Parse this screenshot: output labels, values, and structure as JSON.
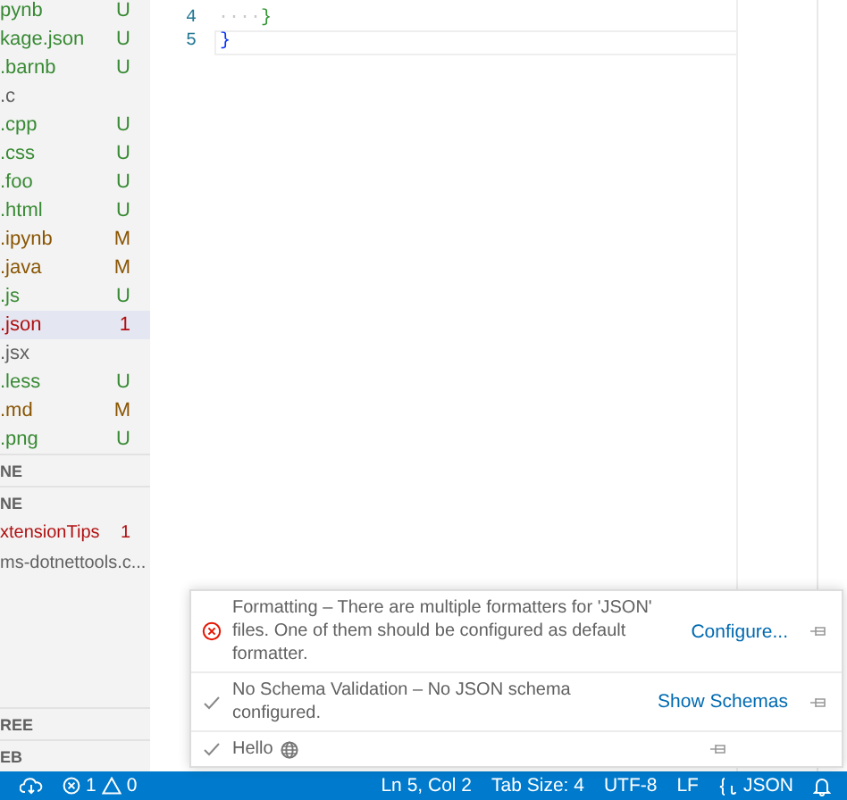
{
  "sidebar": {
    "files": [
      {
        "name": "pynb",
        "status": "U",
        "kind": "untracked",
        "selected": false
      },
      {
        "name": "kage.json",
        "status": "U",
        "kind": "untracked",
        "selected": false
      },
      {
        "name": ".barnb",
        "status": "U",
        "kind": "untracked",
        "selected": false
      },
      {
        "name": ".c",
        "kind": "plain",
        "selected": false
      },
      {
        "name": ".cpp",
        "status": "U",
        "kind": "untracked",
        "selected": false
      },
      {
        "name": ".css",
        "status": "U",
        "kind": "untracked",
        "selected": false
      },
      {
        "name": ".foo",
        "status": "U",
        "kind": "untracked",
        "selected": false
      },
      {
        "name": ".html",
        "status": "U",
        "kind": "untracked",
        "selected": false
      },
      {
        "name": ".ipynb",
        "status": "M",
        "kind": "modified",
        "selected": false
      },
      {
        "name": ".java",
        "status": "M",
        "kind": "modified",
        "selected": false
      },
      {
        "name": ".js",
        "status": "U",
        "kind": "untracked",
        "selected": false
      },
      {
        "name": ".json",
        "status": "1",
        "kind": "error",
        "selected": true
      },
      {
        "name": ".jsx",
        "kind": "plain",
        "selected": false
      },
      {
        "name": ".less",
        "status": "U",
        "kind": "untracked",
        "selected": false
      },
      {
        "name": ".md",
        "status": "M",
        "kind": "modified",
        "selected": false
      },
      {
        "name": ".png",
        "status": "U",
        "kind": "untracked",
        "selected": false
      }
    ],
    "sections_top": [
      {
        "title": "NE"
      },
      {
        "title": "NE",
        "items": [
          {
            "name": "xtensionTips",
            "status": "1",
            "kind": "error"
          },
          {
            "name": "ms-dotnettools.c...",
            "kind": "plain"
          }
        ]
      }
    ],
    "sections_bottom": [
      {
        "title": "REE"
      },
      {
        "title": "EB"
      }
    ]
  },
  "editor": {
    "lines": [
      {
        "number": "4",
        "current": false,
        "tokens": [
          {
            "text": "····",
            "kind": "whitespace"
          },
          {
            "text": "}",
            "kind": "bracket-inner"
          }
        ]
      },
      {
        "number": "5",
        "current": true,
        "tokens": [
          {
            "text": "}",
            "kind": "bracket-outer"
          }
        ]
      }
    ]
  },
  "notifications": [
    {
      "kind": "error",
      "message": "Formatting – There are multiple formatters for 'JSON' files. One of them should be configured as default formatter.",
      "action": "Configure..."
    },
    {
      "kind": "check",
      "message": "No Schema Validation – No JSON schema configured.",
      "action": "Show Schemas"
    },
    {
      "kind": "check-globe",
      "message": "Hello"
    }
  ],
  "status_bar": {
    "errors": "1",
    "warnings": "0",
    "items": [
      "Ln 5, Col 2",
      "Tab Size: 4",
      "UTF-8",
      "LF"
    ],
    "language": "JSON"
  }
}
